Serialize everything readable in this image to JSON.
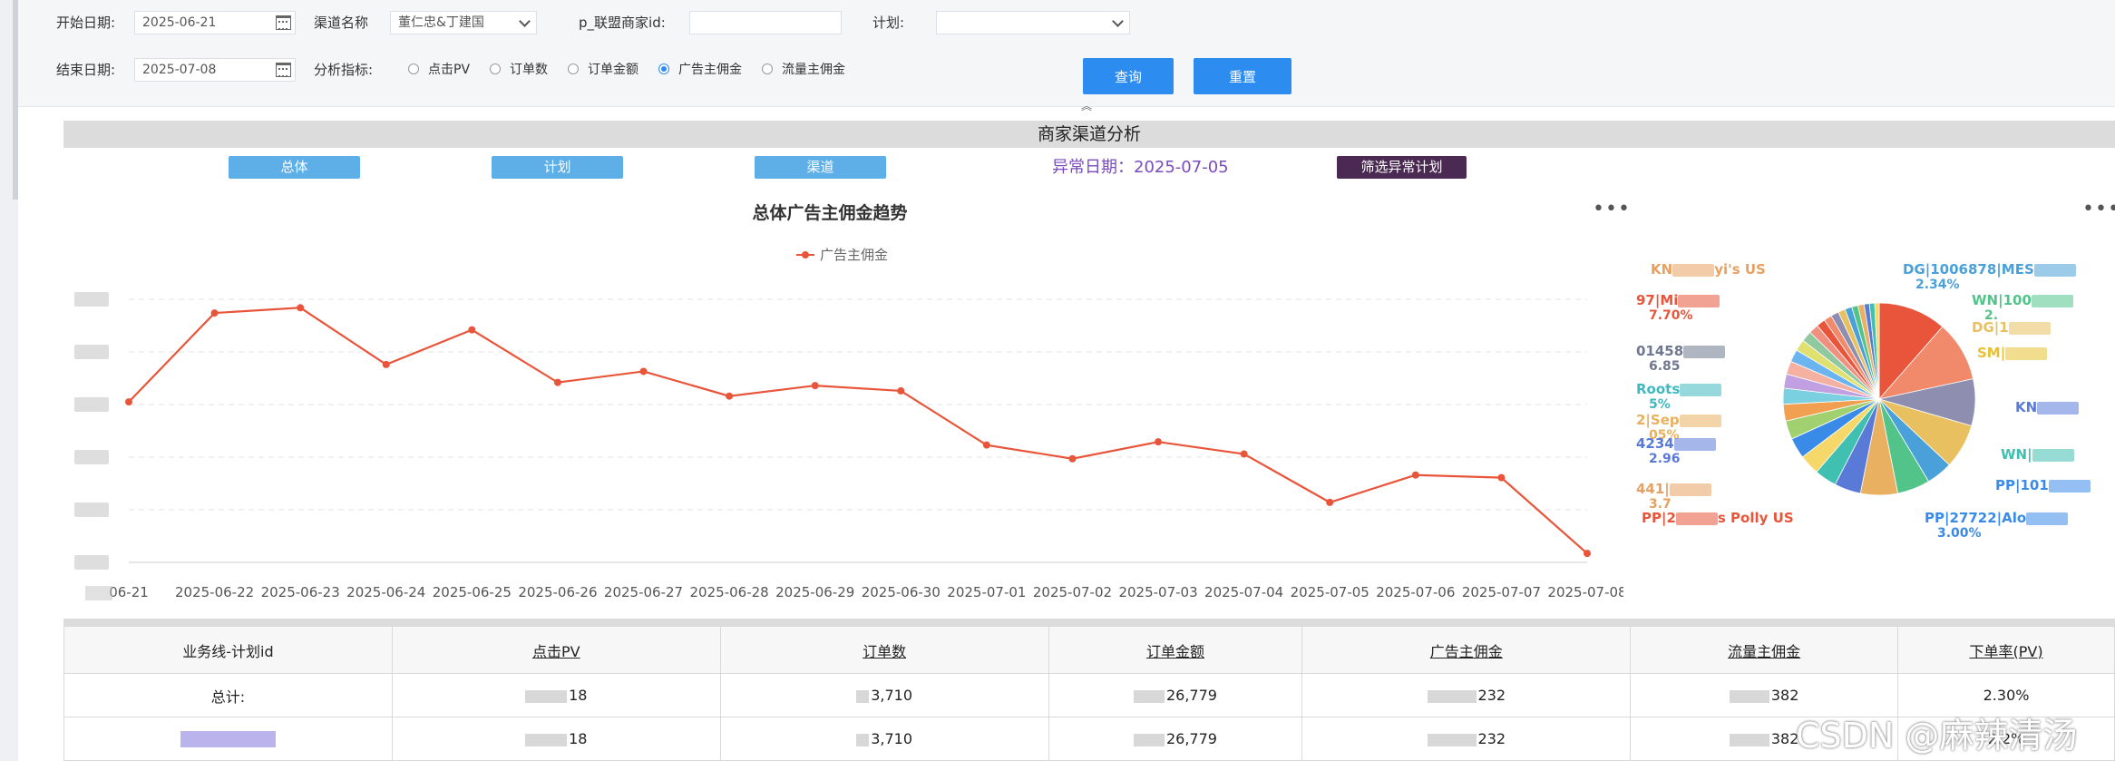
{
  "filters": {
    "start_date_label": "开始日期:",
    "start_date_value": "2025-06-21",
    "end_date_label": "结束日期:",
    "end_date_value": "2025-07-08",
    "channel_label": "渠道名称",
    "channel_value": "董仁忠&丁建国",
    "merchant_id_label": "p_联盟商家id:",
    "plan_label": "计划:",
    "plan_value": "",
    "metric_label": "分析指标:",
    "metric_options": [
      "点击PV",
      "订单数",
      "订单金额",
      "广告主佣金",
      "流量主佣金"
    ],
    "metric_selected": "广告主佣金",
    "query_button": "查询",
    "reset_button": "重置"
  },
  "section": {
    "title": "商家渠道分析",
    "tabs": [
      "总体",
      "计划",
      "渠道"
    ],
    "anomaly_text": "异常日期：2025-07-05",
    "anomaly_button": "筛选异常计划"
  },
  "chart_data": {
    "type": "line",
    "title": "总体广告主佣金趋势",
    "x": [
      "2025-06-21",
      "2025-06-22",
      "2025-06-23",
      "2025-06-24",
      "2025-06-25",
      "2025-06-26",
      "2025-06-27",
      "2025-06-28",
      "2025-06-29",
      "2025-06-30",
      "2025-07-01",
      "2025-07-02",
      "2025-07-03",
      "2025-07-04",
      "2025-07-05",
      "2025-07-06",
      "2025-07-07",
      "2025-07-08"
    ],
    "x_tick_labels": [
      "06-21",
      "2025-06-22",
      "2025-06-23",
      "2025-06-24",
      "2025-06-25",
      "2025-06-26",
      "2025-06-27",
      "2025-06-28",
      "2025-06-29",
      "2025-06-30",
      "2025-07-01",
      "2025-07-02",
      "2025-07-03",
      "2025-07-04",
      "2025-07-05",
      "2025-07-06",
      "2025-07-07",
      "2025-07-08"
    ],
    "series": [
      {
        "name": "广告主佣金",
        "color": "#e8553a",
        "values": [
          3.05,
          4.74,
          4.84,
          3.76,
          4.42,
          3.42,
          3.63,
          3.16,
          3.36,
          3.26,
          2.23,
          1.97,
          2.29,
          2.06,
          1.14,
          1.66,
          1.61,
          0.17
        ]
      }
    ],
    "y_axis": "values masked in screenshot",
    "grid": true,
    "legend": "top-center"
  },
  "pie": {
    "labels": [
      {
        "text": "KN",
        "tail": "yi's US",
        "pct": "",
        "color": "#e8a060"
      },
      {
        "text": "DG|1006878|MES",
        "tail": "",
        "pct": "2.34%",
        "color": "#4aa0d8"
      },
      {
        "text": "97|Mi",
        "tail": "",
        "pct": "7.70%",
        "color": "#e8553a"
      },
      {
        "text": "WN|100",
        "tail": "",
        "pct": "2.",
        "color": "#52c48a"
      },
      {
        "text": "DG|1",
        "tail": "",
        "pct": "",
        "color": "#e8c060"
      },
      {
        "text": "01458",
        "tail": "",
        "pct": "6.85",
        "color": "#707890"
      },
      {
        "text": "SM|",
        "tail": "",
        "pct": "",
        "color": "#e8c030"
      },
      {
        "text": "Roots",
        "tail": "",
        "pct": "5%",
        "color": "#40b8c0"
      },
      {
        "text": "2|Sep",
        "tail": "",
        "pct": "05%",
        "color": "#e8b060"
      },
      {
        "text": "KN",
        "tail": "",
        "pct": "",
        "color": "#5a7ad8"
      },
      {
        "text": "4234",
        "tail": "",
        "pct": "2.96",
        "color": "#5a7ad8"
      },
      {
        "text": "WN|",
        "tail": "",
        "pct": "",
        "color": "#40c0b0"
      },
      {
        "text": "441|",
        "tail": "",
        "pct": "3.7",
        "color": "#e8a060"
      },
      {
        "text": "PP|101",
        "tail": "",
        "pct": "",
        "color": "#3a8ae8"
      },
      {
        "text": "PP|2",
        "tail": "s Polly US",
        "pct": "",
        "color": "#e8553a"
      },
      {
        "text": "PP|27722|Alo",
        "tail": "",
        "pct": "3.00%",
        "color": "#3a8ae8"
      }
    ]
  },
  "table": {
    "headers": [
      "业务线-计划id",
      "点击PV",
      "订单数",
      "订单金额",
      "广告主佣金",
      "流量主佣金",
      "下单率(PV)"
    ],
    "rows": [
      [
        "总计:",
        "18",
        "3,710",
        "26,779",
        "232",
        "382",
        "2.30%"
      ],
      [
        "",
        "18",
        "3,710",
        "26,779",
        "232",
        "382",
        "2.2%"
      ]
    ]
  },
  "watermark": "CSDN @麻辣清汤"
}
